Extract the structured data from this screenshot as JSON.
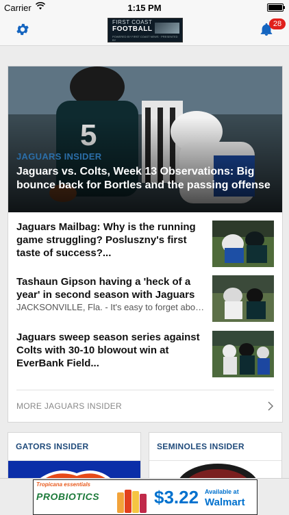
{
  "status_bar": {
    "carrier": "Carrier",
    "time": "1:15 PM"
  },
  "nav": {
    "logo": {
      "line1": "FIRST COAST",
      "line2": "FOOTBALL",
      "line3": "POWERED BY FIRST COAST NEWS · PRESENTED BY"
    },
    "notification_count": "28"
  },
  "featured": {
    "kicker": "JAGUARS INSIDER",
    "headline": "Jaguars vs. Colts, Week 13 Observations: Big bounce back for Bortles and the passing offense",
    "image": "football-photo-jaguars-qb-vs-colts"
  },
  "stories": [
    {
      "title": "Jaguars Mailbag: Why is the running game struggling? Posluszny's first taste of success?...",
      "snippet": ""
    },
    {
      "title": "Tashaun Gipson having a 'heck of a year' in second season with Jaguars",
      "snippet": "JACKSONVILLE, Fla. - It's easy to forget about the Jaguars' safeties with all of the t..."
    },
    {
      "title": "Jaguars sweep season series against Colts with 30-10 blowout win at EverBank Field...",
      "snippet": ""
    }
  ],
  "more_label": "MORE JAGUARS INSIDER",
  "sections": [
    {
      "title": "GATORS INSIDER"
    },
    {
      "title": "SEMINOLES INSIDER"
    }
  ],
  "ad": {
    "brand_top": "Tropicana essentials",
    "brand_main": "PROBIOTICS",
    "price": "$3.22",
    "available": "Available at",
    "retailer": "Walmart"
  },
  "colors": {
    "accent": "#1f4a7a",
    "kicker": "#2b6ea8",
    "badge": "#e0201c",
    "icon": "#1565c0"
  }
}
